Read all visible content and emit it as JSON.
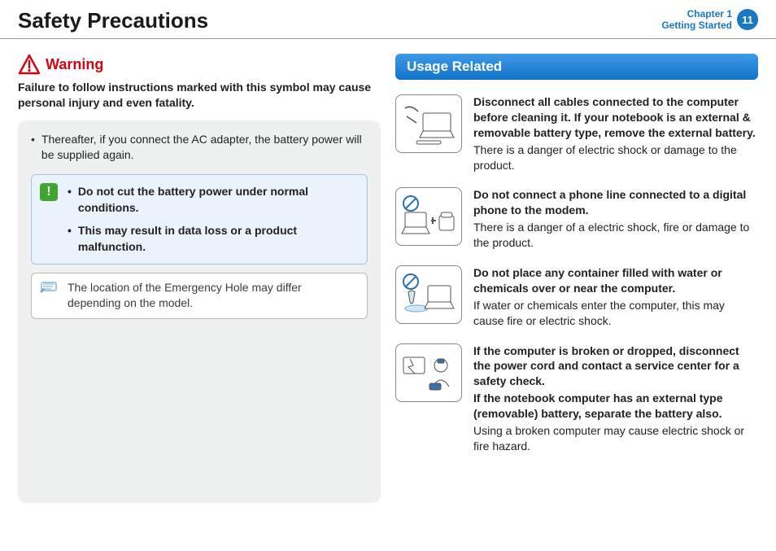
{
  "header": {
    "title": "Safety Precautions",
    "chapter_line1": "Chapter 1",
    "chapter_line2": "Getting Started",
    "page_number": "11"
  },
  "left": {
    "warning_label": "Warning",
    "warning_lead": "Failure to follow instructions marked with this symbol may cause personal injury and even fatality.",
    "grey_bullet": "Thereafter, if you connect the AC adapter, the battery power will be supplied again.",
    "callout_1": "Do not cut the battery power under normal conditions.",
    "callout_2": "This may result in data loss or a product malfunction.",
    "note": "The location of the Emergency Hole may differ depending on the model."
  },
  "right": {
    "section_title": "Usage Related",
    "items": [
      {
        "bold": "Disconnect all cables connected to the computer before cleaning it. If your notebook is an external & removable battery type, remove the external battery.",
        "reg": "There is a danger of electric shock or damage to the product."
      },
      {
        "bold": "Do not connect a phone line connected to a digital phone to the modem.",
        "reg": "There is a danger of a electric shock, fire or damage to the product."
      },
      {
        "bold": "Do not place any container filled with water or chemicals over or near the computer.",
        "reg": "If water or chemicals enter the computer, this may cause fire or electric shock."
      },
      {
        "bold": "If the computer is broken or dropped, disconnect the power cord and contact a service center for a safety check.",
        "bold2": "If the notebook computer has an external type (removable) battery, separate the battery also.",
        "reg": "Using a broken computer may cause electric shock or fire hazard."
      }
    ]
  }
}
